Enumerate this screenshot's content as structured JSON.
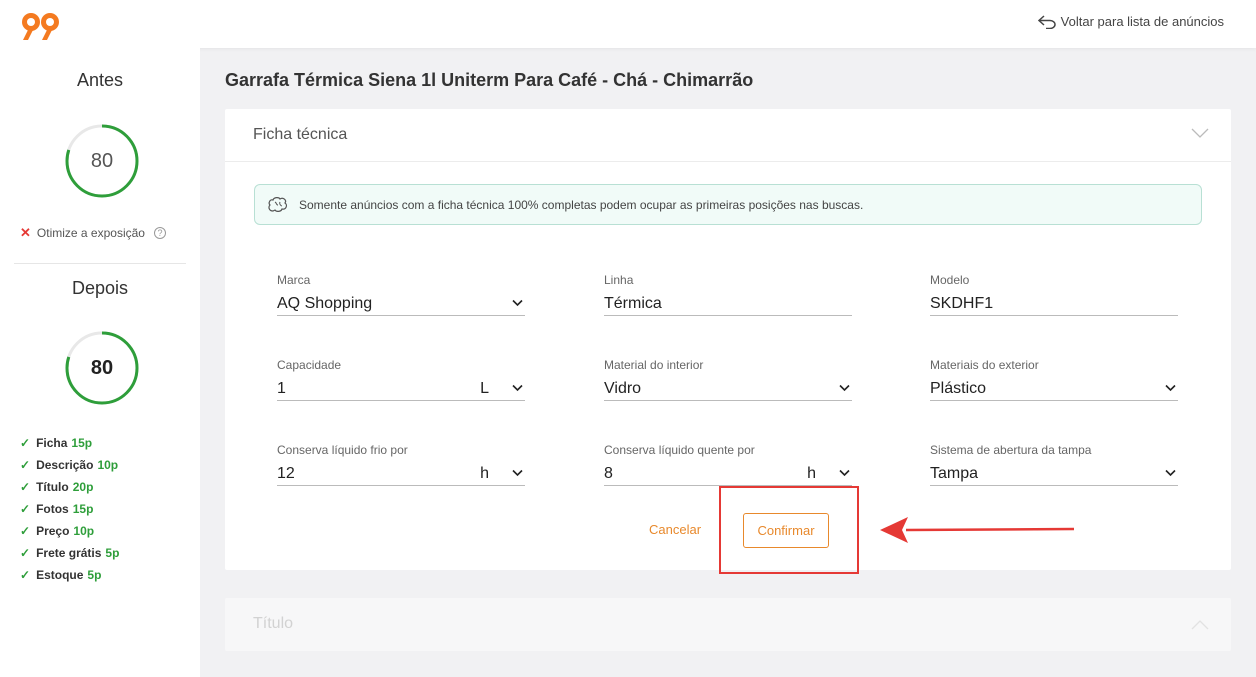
{
  "header": {
    "back_label": "Voltar para lista de anúncios",
    "brand_color": "#f47a20"
  },
  "sidebar": {
    "before_title": "Antes",
    "before_score": "80",
    "before_score_fraction": 0.8,
    "optimize_label": "Otimize a exposição",
    "after_title": "Depois",
    "after_score": "80",
    "after_score_fraction": 0.8,
    "gauge_color": "#2e9e3a",
    "checks": [
      {
        "label": "Ficha",
        "points": "15p"
      },
      {
        "label": "Descrição",
        "points": "10p"
      },
      {
        "label": "Título",
        "points": "20p"
      },
      {
        "label": "Fotos",
        "points": "15p"
      },
      {
        "label": "Preço",
        "points": "10p"
      },
      {
        "label": "Frete grátis",
        "points": "5p"
      },
      {
        "label": "Estoque",
        "points": "5p"
      }
    ]
  },
  "main": {
    "product_title": "Garrafa Térmica Siena 1l Uniterm Para Café - Chá - Chimarrão",
    "section_title": "Ficha técnica",
    "info_text": "Somente anúncios com a ficha técnica 100% completas podem ocupar as primeiras posições nas buscas.",
    "fields": {
      "marca": {
        "label": "Marca",
        "value": "AQ Shopping"
      },
      "linha": {
        "label": "Linha",
        "value": "Térmica"
      },
      "modelo": {
        "label": "Modelo",
        "value": "SKDHF1"
      },
      "capacidade": {
        "label": "Capacidade",
        "value": "1",
        "unit": "L"
      },
      "material_interior": {
        "label": "Material do interior",
        "value": "Vidro"
      },
      "materiais_exterior": {
        "label": "Materiais do exterior",
        "value": "Plástico"
      },
      "conserva_frio": {
        "label": "Conserva líquido frio por",
        "value": "12",
        "unit": "h"
      },
      "conserva_quente": {
        "label": "Conserva líquido quente por",
        "value": "8",
        "unit": "h"
      },
      "sistema_tampa": {
        "label": "Sistema de abertura da tampa",
        "value": "Tampa"
      }
    },
    "cancel_label": "Cancelar",
    "confirm_label": "Confirmar",
    "next_section_title": "Título"
  }
}
